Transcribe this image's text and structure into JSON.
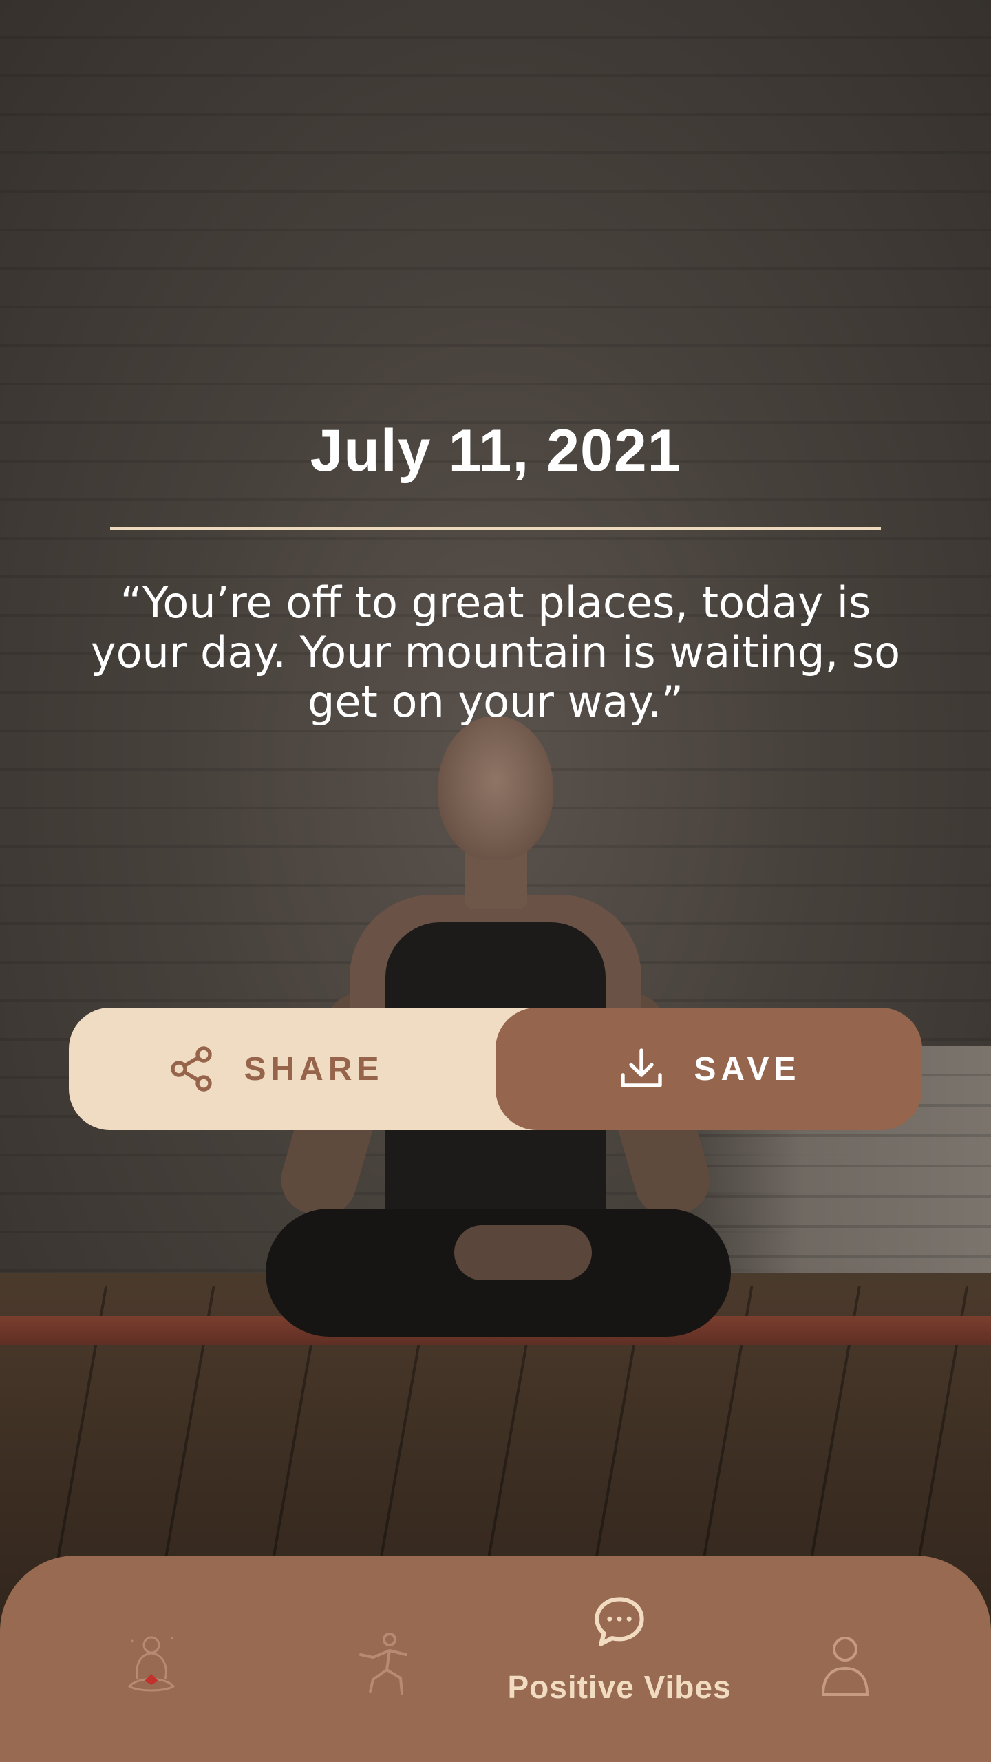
{
  "header": {
    "date": "July 11, 2021"
  },
  "quote": {
    "text": "“You’re off to great places, today is your day. Your mountain is waiting, so get on your way.”"
  },
  "actions": {
    "share_label": "SHARE",
    "save_label": "SAVE"
  },
  "bottom_nav": {
    "items": [
      {
        "id": "home",
        "icon": "meditation-logo-icon",
        "label": ""
      },
      {
        "id": "yoga",
        "icon": "yoga-pose-icon",
        "label": ""
      },
      {
        "id": "positive-vibes",
        "icon": "chat-bubble-icon",
        "label": "Positive Vibes",
        "active": true
      },
      {
        "id": "profile",
        "icon": "person-icon",
        "label": ""
      }
    ]
  },
  "colors": {
    "accent_brown": "#96654e",
    "cream": "#efdcc3",
    "nav_background": "#976a51",
    "text_light": "#ffffff"
  }
}
